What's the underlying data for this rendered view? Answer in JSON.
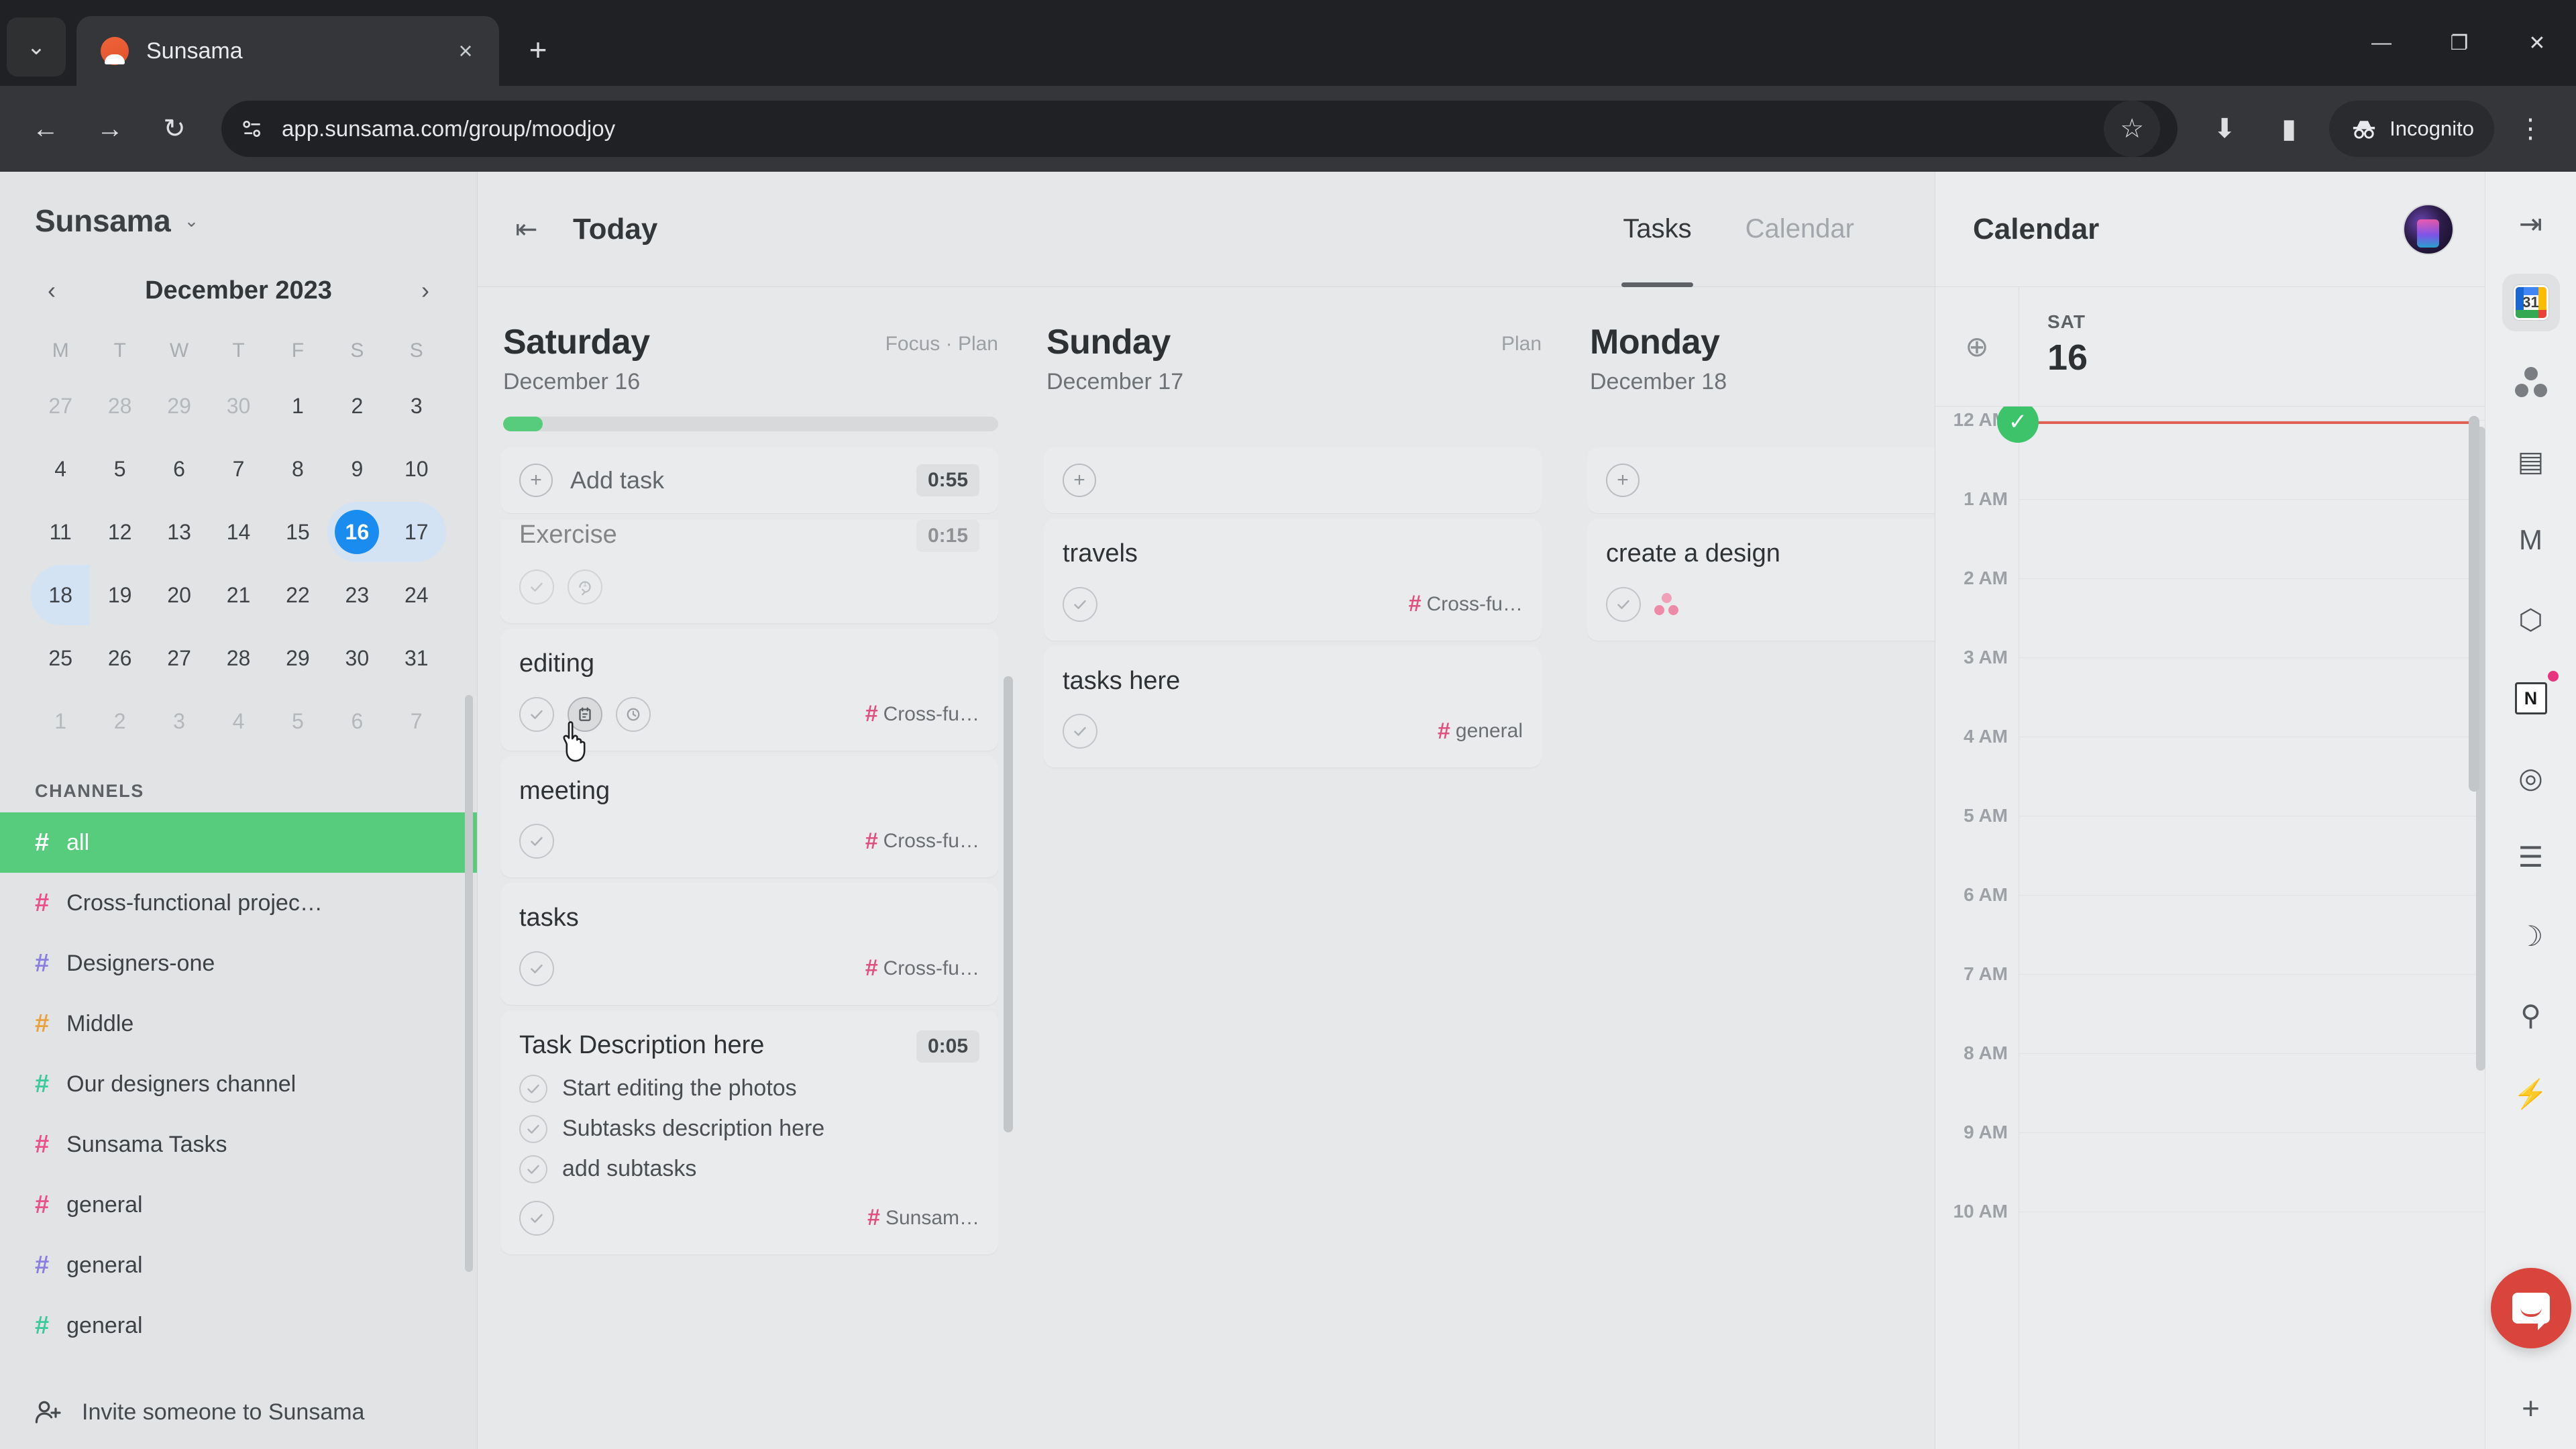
{
  "browser": {
    "tab_title": "Sunsama",
    "tab_close_glyph": "×",
    "new_tab_glyph": "+",
    "chevron_glyph": "⌄",
    "back_glyph": "←",
    "forward_glyph": "→",
    "reload_glyph": "↻",
    "url": "app.sunsama.com/group/moodjoy",
    "star_glyph": "☆",
    "download_glyph": "⬇",
    "sidepanel_glyph": "▮",
    "incognito_label": "Incognito",
    "incognito_glyph": "🕵",
    "menu_glyph": "⋮",
    "minimize_glyph": "—",
    "maximize_glyph": "❐",
    "close_glyph": "✕"
  },
  "sidebar": {
    "workspace_name": "Sunsama",
    "workspace_chevron": "⌄",
    "calendar": {
      "month_title": "December 2023",
      "prev_glyph": "‹",
      "next_glyph": "›",
      "dow": [
        "M",
        "T",
        "W",
        "T",
        "F",
        "S",
        "S"
      ],
      "weeks": [
        [
          {
            "d": "27",
            "muted": true
          },
          {
            "d": "28",
            "muted": true
          },
          {
            "d": "29",
            "muted": true
          },
          {
            "d": "30",
            "muted": true
          },
          {
            "d": "1"
          },
          {
            "d": "2"
          },
          {
            "d": "3"
          }
        ],
        [
          {
            "d": "4"
          },
          {
            "d": "5"
          },
          {
            "d": "6"
          },
          {
            "d": "7"
          },
          {
            "d": "8"
          },
          {
            "d": "9"
          },
          {
            "d": "10"
          }
        ],
        [
          {
            "d": "11"
          },
          {
            "d": "12"
          },
          {
            "d": "13"
          },
          {
            "d": "14"
          },
          {
            "d": "15"
          },
          {
            "d": "16",
            "today": true,
            "hl": "l"
          },
          {
            "d": "17",
            "hl": "r"
          }
        ],
        [
          {
            "d": "18",
            "hl": "l"
          },
          {
            "d": "19"
          },
          {
            "d": "20"
          },
          {
            "d": "21"
          },
          {
            "d": "22"
          },
          {
            "d": "23"
          },
          {
            "d": "24"
          }
        ],
        [
          {
            "d": "25"
          },
          {
            "d": "26"
          },
          {
            "d": "27"
          },
          {
            "d": "28"
          },
          {
            "d": "29"
          },
          {
            "d": "30"
          },
          {
            "d": "31"
          }
        ],
        [
          {
            "d": "1",
            "muted": true
          },
          {
            "d": "2",
            "muted": true
          },
          {
            "d": "3",
            "muted": true
          },
          {
            "d": "4",
            "muted": true
          },
          {
            "d": "5",
            "muted": true
          },
          {
            "d": "6",
            "muted": true
          },
          {
            "d": "7",
            "muted": true
          }
        ]
      ]
    },
    "channels_header": "CHANNELS",
    "channels": [
      {
        "label": "all",
        "color": "#ffffff",
        "active": true
      },
      {
        "label": "Cross-functional projec…",
        "color": "#e8518a"
      },
      {
        "label": "Designers-one",
        "color": "#8a7fe0"
      },
      {
        "label": "Middle",
        "color": "#e8a33d"
      },
      {
        "label": "Our designers channel",
        "color": "#3ec99a"
      },
      {
        "label": "Sunsama Tasks",
        "color": "#e8518a"
      },
      {
        "label": "general",
        "color": "#e8518a"
      },
      {
        "label": "general",
        "color": "#8a7fe0"
      },
      {
        "label": "general",
        "color": "#3ec99a"
      }
    ],
    "invite_label": "Invite someone to Sunsama",
    "invite_glyph": "☺+"
  },
  "board": {
    "collapse_glyph": "⇤",
    "today_label": "Today",
    "tabs": [
      {
        "label": "Tasks",
        "active": true
      },
      {
        "label": "Calendar",
        "active": false
      }
    ],
    "add_task_label": "Add task",
    "plus_glyph": "+",
    "columns": [
      {
        "day": "Saturday",
        "date": "December 16",
        "tags": "Focus · Plan",
        "progress_percent": 8,
        "show_progress": true,
        "add_task_time": "0:55",
        "add_task_label_visible": true,
        "cards": [
          {
            "title": "Exercise",
            "time": "0:15",
            "clipped": true,
            "actions": [
              "check",
              "repeat"
            ],
            "channel": null
          },
          {
            "title": "editing",
            "time": null,
            "actions": [
              "check",
              "note",
              "clock"
            ],
            "hovered_action_index": 1,
            "channel": "Cross-fu…",
            "cursor": true
          },
          {
            "title": "meeting",
            "time": null,
            "actions": [
              "check"
            ],
            "channel": "Cross-fu…"
          },
          {
            "title": "tasks",
            "time": null,
            "actions": [
              "check"
            ],
            "channel": "Cross-fu…"
          },
          {
            "title": "Task Description here",
            "time": "0:05",
            "actions": [
              "check"
            ],
            "channel": "Sunsam…",
            "subtasks": [
              "Start editing the photos",
              "Subtasks description here",
              "add subtasks"
            ]
          }
        ]
      },
      {
        "day": "Sunday",
        "date": "December 17",
        "tags": "Plan",
        "progress_percent": 0,
        "show_progress": false,
        "add_task_time": null,
        "add_task_label_visible": false,
        "cards": [
          {
            "title": "travels",
            "time": null,
            "actions": [
              "check"
            ],
            "channel": "Cross-fu…"
          },
          {
            "title": "tasks here",
            "time": null,
            "actions": [
              "check"
            ],
            "channel": "general"
          }
        ]
      },
      {
        "day": "Monday",
        "date": "December 18",
        "tags": "",
        "progress_percent": 0,
        "show_progress": false,
        "add_task_time": null,
        "add_task_label_visible": false,
        "cards": [
          {
            "title": "create a design",
            "time": null,
            "actions": [
              "check"
            ],
            "channel": null,
            "asana_badge": true
          }
        ]
      }
    ]
  },
  "rightcal": {
    "title": "Calendar",
    "zoom_glyph": "⊕",
    "dow": "SAT",
    "day_number": "16",
    "now_check_glyph": "✓",
    "times": [
      "12 AM",
      "1 AM",
      "2 AM",
      "3 AM",
      "4 AM",
      "5 AM",
      "6 AM",
      "7 AM",
      "8 AM",
      "9 AM",
      "10 AM"
    ]
  },
  "rail": {
    "collapse_glyph": "⇥",
    "items": [
      {
        "name": "google-calendar-icon",
        "kind": "gcal",
        "label": "31",
        "selected": true
      },
      {
        "name": "asana-icon",
        "kind": "asana"
      },
      {
        "name": "trello-icon",
        "kind": "glyph",
        "glyph": "▤"
      },
      {
        "name": "gmail-icon",
        "kind": "glyph",
        "glyph": "M"
      },
      {
        "name": "github-icon",
        "kind": "glyph",
        "glyph": "⬡"
      },
      {
        "name": "notion-icon",
        "kind": "notion",
        "label": "N",
        "badge": true
      },
      {
        "name": "target-icon",
        "kind": "glyph",
        "glyph": "◎"
      },
      {
        "name": "archive-icon",
        "kind": "glyph",
        "glyph": "☰"
      },
      {
        "name": "night-mode-icon",
        "kind": "glyph",
        "glyph": "☽"
      },
      {
        "name": "search-icon",
        "kind": "glyph",
        "glyph": "⚲"
      },
      {
        "name": "shortcut-icon",
        "kind": "glyph",
        "glyph": "⚡"
      }
    ],
    "plus_glyph": "+"
  },
  "colors": {
    "accent_green": "#57cc7d",
    "today_blue": "#1a8cf0",
    "channel_pink": "#e0507f",
    "now_line_red": "#e06055",
    "app_bg": "#e1e3e5",
    "card_bg": "#eaebed"
  }
}
